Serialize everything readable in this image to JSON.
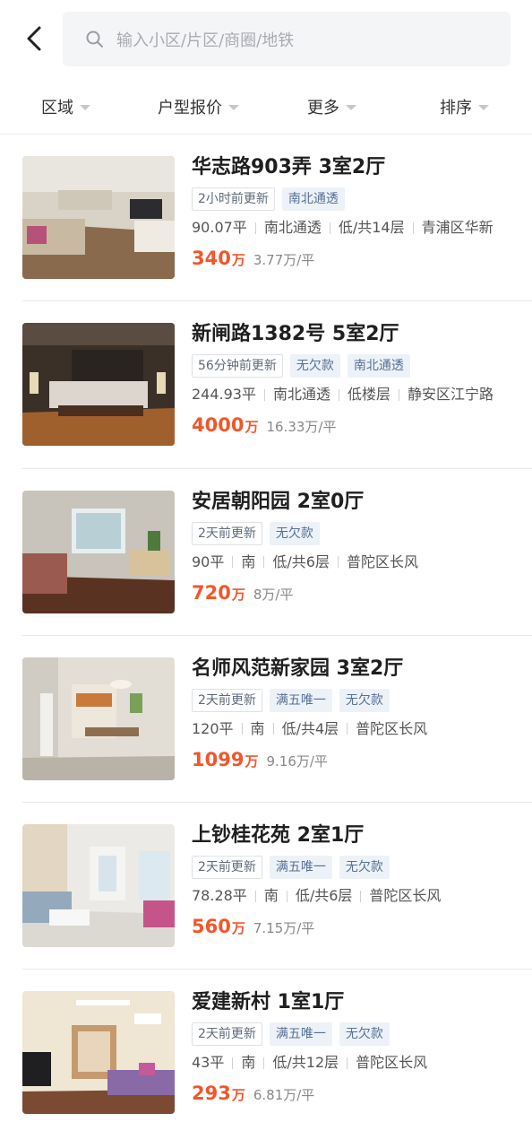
{
  "search": {
    "placeholder": "输入小区/片区/商圈/地铁"
  },
  "filters": [
    {
      "label": "区域"
    },
    {
      "label": "户型报价"
    },
    {
      "label": "更多"
    },
    {
      "label": "排序"
    }
  ],
  "colors": {
    "price": "#f0572b",
    "tag_feature_bg": "#edf2f8",
    "search_bg": "#f4f5f7"
  },
  "listings": [
    {
      "title": "华志路903弄 3室2厅",
      "update": "2小时前更新",
      "features": [
        "南北通透"
      ],
      "attrs": [
        "90.07平",
        "南北通透",
        "低/共14层",
        "青浦区华新"
      ],
      "price": "340",
      "price_unit": "万",
      "unit_price": "3.77万/平",
      "photo": "living-room-photo"
    },
    {
      "title": "新闸路1382号 5室2厅",
      "update": "56分钟前更新",
      "features": [
        "无欠款",
        "南北通透"
      ],
      "attrs": [
        "244.93平",
        "南北通透",
        "低楼层",
        "静安区江宁路"
      ],
      "price": "4000",
      "price_unit": "万",
      "unit_price": "16.33万/平",
      "photo": "bedroom-photo"
    },
    {
      "title": "安居朝阳园 2室0厅",
      "update": "2天前更新",
      "features": [
        "无欠款"
      ],
      "attrs": [
        "90平",
        "南",
        "低/共6层",
        "普陀区长风"
      ],
      "price": "720",
      "price_unit": "万",
      "unit_price": "8万/平",
      "photo": "living-room-photo"
    },
    {
      "title": "名师风范新家园 3室2厅",
      "update": "2天前更新",
      "features": [
        "满五唯一",
        "无欠款"
      ],
      "attrs": [
        "120平",
        "南",
        "低/共4层",
        "普陀区长风"
      ],
      "price": "1099",
      "price_unit": "万",
      "unit_price": "9.16万/平",
      "photo": "dining-room-photo"
    },
    {
      "title": "上钞桂花苑 2室1厅",
      "update": "2天前更新",
      "features": [
        "满五唯一",
        "无欠款"
      ],
      "attrs": [
        "78.28平",
        "南",
        "低/共6层",
        "普陀区长风"
      ],
      "price": "560",
      "price_unit": "万",
      "unit_price": "7.15万/平",
      "photo": "living-room-photo"
    },
    {
      "title": "爱建新村 1室1厅",
      "update": "2天前更新",
      "features": [
        "满五唯一",
        "无欠款"
      ],
      "attrs": [
        "43平",
        "南",
        "低/共12层",
        "普陀区长风"
      ],
      "price": "293",
      "price_unit": "万",
      "unit_price": "6.81万/平",
      "photo": "living-room-photo"
    }
  ]
}
